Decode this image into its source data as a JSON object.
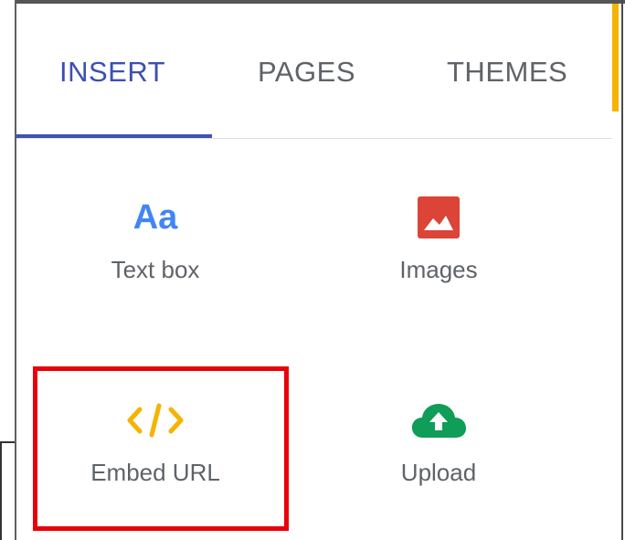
{
  "tabs": [
    {
      "label": "INSERT",
      "active": true
    },
    {
      "label": "PAGES",
      "active": false
    },
    {
      "label": "THEMES",
      "active": false
    }
  ],
  "insert_items": [
    {
      "label": "Text box",
      "icon": "text-aa-icon",
      "glyph": "Aa"
    },
    {
      "label": "Images",
      "icon": "image-icon"
    },
    {
      "label": "Embed URL",
      "icon": "code-icon"
    },
    {
      "label": "Upload",
      "icon": "cloud-upload-icon"
    }
  ],
  "colors": {
    "active_tab": "#3c4fb5",
    "inactive_tab": "#5f6368",
    "accent_strip": "#f4b400",
    "text_icon": "#4285f4",
    "images_icon": "#db4437",
    "embed_icon": "#f4b400",
    "upload_icon": "#0f9d58",
    "highlight": "#e8000b"
  }
}
